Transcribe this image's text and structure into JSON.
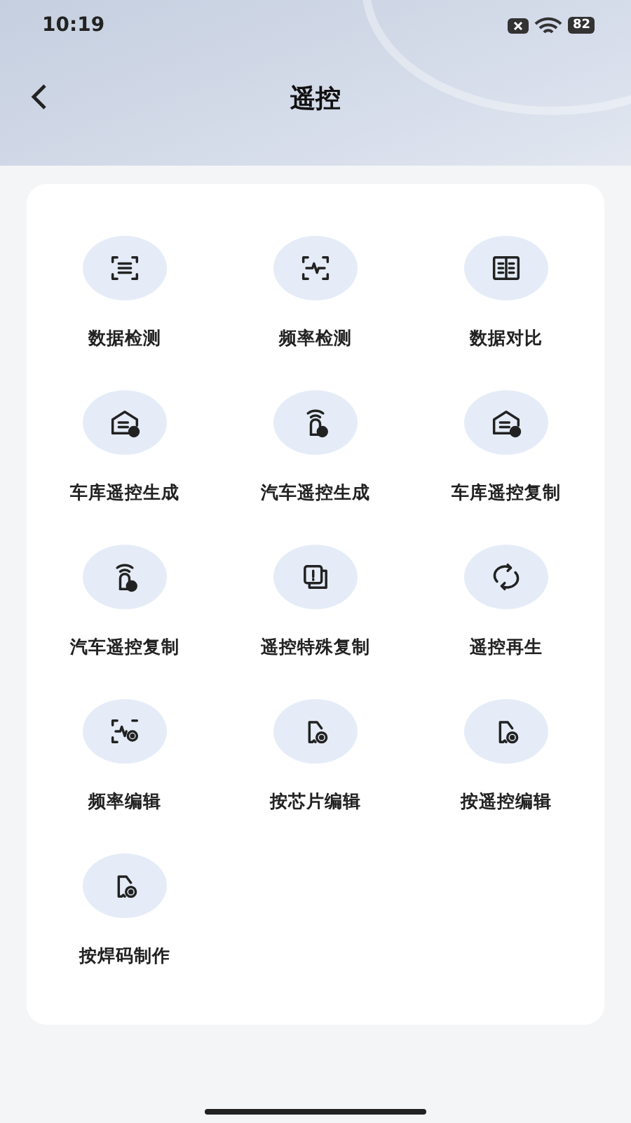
{
  "status_bar": {
    "time": "10:19",
    "battery": "82"
  },
  "header": {
    "title": "遥控"
  },
  "functions": [
    {
      "label": "数据检测",
      "kind": "scan-lines"
    },
    {
      "label": "频率检测",
      "kind": "scan-wave"
    },
    {
      "label": "数据对比",
      "kind": "compare"
    },
    {
      "label": "车库遥控生成",
      "kind": "garage"
    },
    {
      "label": "汽车遥控生成",
      "kind": "car-key"
    },
    {
      "label": "车库遥控复制",
      "kind": "garage"
    },
    {
      "label": "汽车遥控复制",
      "kind": "car-key"
    },
    {
      "label": "遥控特殊复制",
      "kind": "copy-alert"
    },
    {
      "label": "遥控再生",
      "kind": "cycle"
    },
    {
      "label": "频率编辑",
      "kind": "wave-gear"
    },
    {
      "label": "按芯片编辑",
      "kind": "chip-gear"
    },
    {
      "label": "按遥控编辑",
      "kind": "chip-gear"
    },
    {
      "label": "按焊码制作",
      "kind": "chip-gear"
    }
  ]
}
